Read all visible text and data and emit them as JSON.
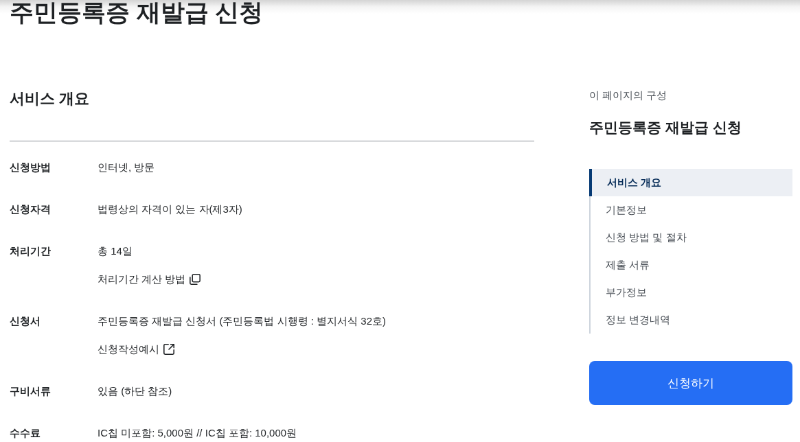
{
  "page_title": "주민등록증 재발급 신청",
  "section": {
    "title": "서비스 개요",
    "rows": [
      {
        "label": "신청방법",
        "lines": [
          {
            "kind": "text",
            "text": "인터넷, 방문"
          }
        ]
      },
      {
        "label": "신청자격",
        "lines": [
          {
            "kind": "text",
            "text": "법령상의 자격이 있는 자(제3자)"
          }
        ]
      },
      {
        "label": "처리기간",
        "lines": [
          {
            "kind": "text",
            "text": "총 14일"
          },
          {
            "kind": "popup_link",
            "text": "처리기간 계산 방법"
          }
        ]
      },
      {
        "label": "신청서",
        "lines": [
          {
            "kind": "text",
            "text": "주민등록증 재발급 신청서 (주민등록법 시행령 : 별지서식 32호)"
          },
          {
            "kind": "external_link",
            "text": "신청작성예시"
          }
        ]
      },
      {
        "label": "구비서류",
        "lines": [
          {
            "kind": "text",
            "text": "있음 (하단 참조)"
          }
        ]
      },
      {
        "label": "수수료",
        "lines": [
          {
            "kind": "text",
            "text": "IC칩 미포함: 5,000원 // IC칩 포함: 10,000원"
          }
        ]
      }
    ]
  },
  "toc": {
    "caption": "이 페이지의 구성",
    "title": "주민등록증 재발급 신청",
    "items": [
      {
        "label": "서비스 개요",
        "selected": true
      },
      {
        "label": "기본정보",
        "selected": false
      },
      {
        "label": "신청 방법 및 절차",
        "selected": false
      },
      {
        "label": "제출 서류",
        "selected": false
      },
      {
        "label": "부가정보",
        "selected": false
      },
      {
        "label": "정보 변경내역",
        "selected": false
      }
    ]
  },
  "apply_button": {
    "label": "신청하기"
  }
}
